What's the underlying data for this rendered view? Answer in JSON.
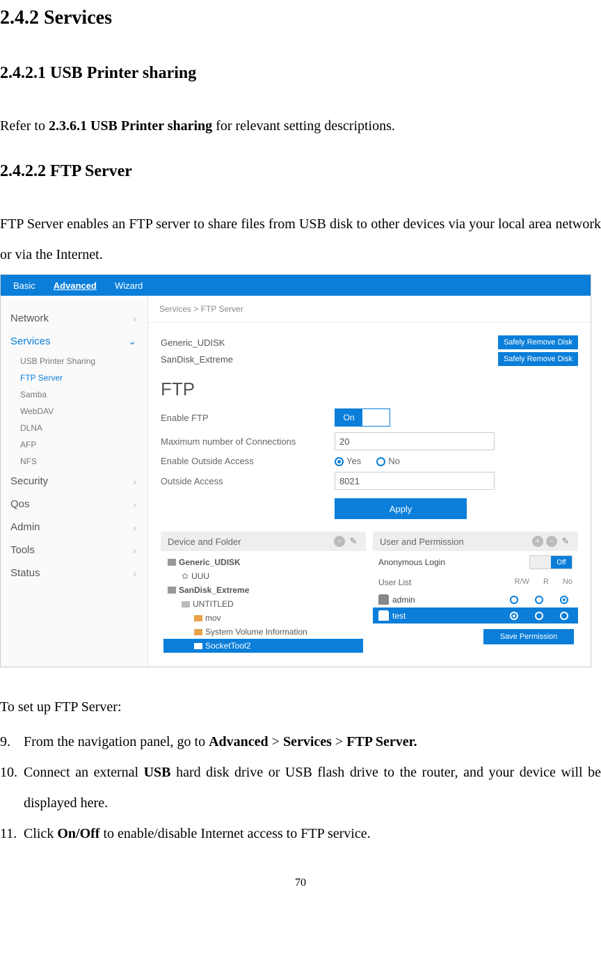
{
  "doc": {
    "h_services": "2.4.2 Services",
    "h_usbprint": "2.4.2.1 USB Printer sharing",
    "p_refer_pre": "Refer to ",
    "p_refer_bold": "2.3.6.1 USB Printer sharing",
    "p_refer_post": " for relevant setting descriptions.",
    "h_ftp": "2.4.2.2 FTP Server",
    "p_ftp_desc": "FTP Server enables an FTP server to share files from USB disk to other devices via your local area network or via the Internet.",
    "p_setup": "To set up FTP Server:",
    "li9_num": "9.",
    "li9_a": "From the navigation panel, go to ",
    "li9_b1": "Advanced",
    "li9_b2": " > ",
    "li9_b3": "Services",
    "li9_b4": " > ",
    "li9_b5": "FTP Server.",
    "li10_num": "10.",
    "li10_a": "Connect an external ",
    "li10_b": "USB",
    "li10_c": " hard disk drive or USB flash drive to the router, and your device will be displayed here.",
    "li11_num": "11.",
    "li11_a": "Click ",
    "li11_b": "On/Off",
    "li11_c": " to enable/disable Internet access to FTP service.",
    "page_number": "70"
  },
  "shot": {
    "tabs": {
      "basic": "Basic",
      "advanced": "Advanced",
      "wizard": "Wizard"
    },
    "breadcrumb": "Services > FTP Server",
    "sidebar": {
      "network": "Network",
      "services": "Services",
      "sub": {
        "usb": "USB Printer Sharing",
        "ftp": "FTP Server",
        "samba": "Samba",
        "webdav": "WebDAV",
        "dlna": "DLNA",
        "afp": "AFP",
        "nfs": "NFS"
      },
      "security": "Security",
      "qos": "Qos",
      "admin": "Admin",
      "tools": "Tools",
      "status": "Status"
    },
    "disks": {
      "d0": "Generic_UDISK",
      "d1": "SanDisk_Extreme",
      "remove": "Safely Remove Disk"
    },
    "ftp": {
      "title": "FTP",
      "lbl_enable": "Enable FTP",
      "toggle_on": "On",
      "lbl_max": "Maximum number of Connections",
      "val_max": "20",
      "lbl_outside": "Enable Outside Access",
      "opt_yes": "Yes",
      "opt_no": "No",
      "lbl_outport": "Outside Access",
      "val_outport": "8021",
      "apply": "Apply"
    },
    "devcol": {
      "head": "Device and Folder",
      "d0": "Generic_UDISK",
      "d0f0": "UUU",
      "d1": "SanDisk_Extreme",
      "d1f0": "UNTITLED",
      "d1f1": "mov",
      "d1f2": "System Volume Information",
      "d1f3": "SocketTool2"
    },
    "usercol": {
      "head": "User and Permission",
      "anon": "Anonymous Login",
      "anon_off": "Off",
      "ul": "User List",
      "col_rw": "R/W",
      "col_r": "R",
      "col_no": "No",
      "u0": "admin",
      "u1": "test",
      "save": "Save Permission"
    }
  }
}
